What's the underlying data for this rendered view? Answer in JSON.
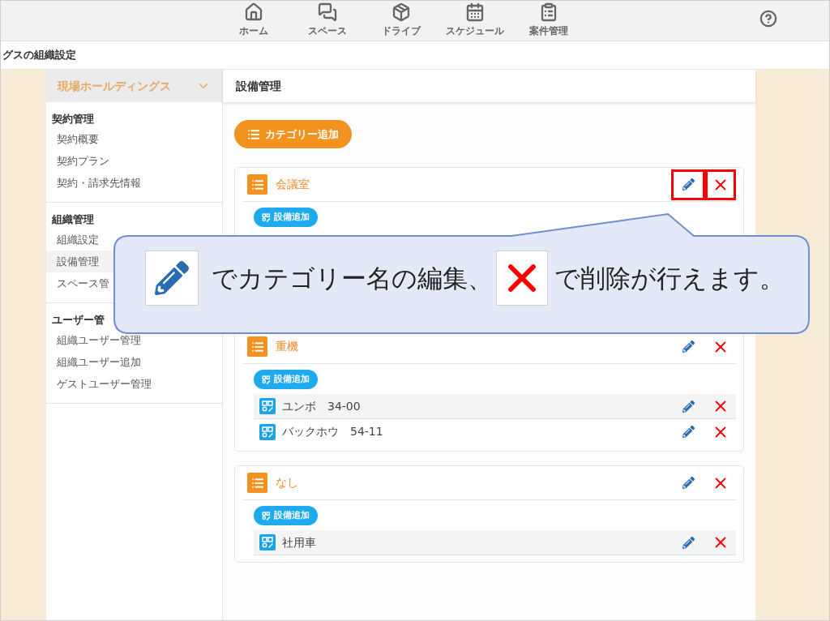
{
  "nav": {
    "items": [
      {
        "label": "ホーム",
        "kind": "home"
      },
      {
        "label": "スペース",
        "kind": "space"
      },
      {
        "label": "ドライブ",
        "kind": "drive"
      },
      {
        "label": "スケジュール",
        "kind": "schedule"
      },
      {
        "label": "案件管理",
        "kind": "case"
      }
    ]
  },
  "breadcrumb": "グスの組織設定",
  "sidebar": {
    "org": "現場ホールディングス",
    "sections": [
      {
        "title": "契約管理",
        "items": [
          {
            "label": "契約概要",
            "selected": false
          },
          {
            "label": "契約プラン",
            "selected": false
          },
          {
            "label": "契約・請求先情報",
            "selected": false
          }
        ]
      },
      {
        "title": "組織管理",
        "items": [
          {
            "label": "組織設定",
            "selected": false
          },
          {
            "label": "設備管理",
            "selected": true
          },
          {
            "label": "スペース管",
            "selected": false
          }
        ]
      },
      {
        "title": "ユーザー管",
        "items": [
          {
            "label": "組織ユーザー管理",
            "selected": false
          },
          {
            "label": "組織ユーザー追加",
            "selected": false
          },
          {
            "label": "ゲストユーザー管理",
            "selected": false
          }
        ]
      }
    ]
  },
  "main": {
    "title": "設備管理",
    "add_category": "カテゴリー追加",
    "categories": [
      {
        "name": "会議室",
        "add_equipment": "設備追加",
        "highlighted": true
      },
      {
        "name": "重機",
        "add_equipment": "設備追加",
        "highlighted": false,
        "items": [
          "ユンボ　34-00",
          "バックホウ　54-11"
        ]
      },
      {
        "name": "なし",
        "add_equipment": "設備追加",
        "highlighted": false,
        "items": [
          "社用車"
        ]
      }
    ]
  },
  "callout": {
    "text_before": "でカテゴリー名の編集、",
    "text_after": "で削除が行えます。"
  }
}
